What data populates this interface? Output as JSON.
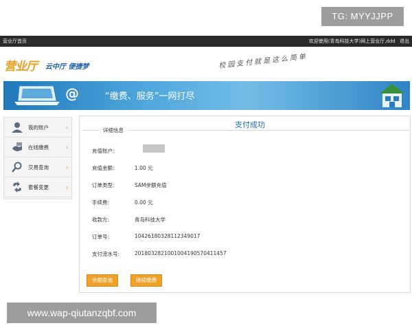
{
  "watermarks": {
    "tg": "TG: MYYJJPP",
    "url": "www.wap-qiutanzqbf.com"
  },
  "topbar": {
    "home": "营业厅首页",
    "welcome": "欢迎使用(青岛科技大学)网上营业厅,ddd",
    "logout": "退出"
  },
  "header": {
    "logo": "营业厅",
    "logo_sub": "云中厅 便捷梦",
    "slogan": "校园支付就是这么简单"
  },
  "banner": {
    "text": "“缴费、服务”一网打尽",
    "icon": "at-sign-icon"
  },
  "sidebar": {
    "items": [
      {
        "label": "我的账户",
        "icon": "user-icon"
      },
      {
        "label": "在线缴费",
        "icon": "payment-icon"
      },
      {
        "label": "交易查询",
        "icon": "search-icon"
      },
      {
        "label": "套餐变更",
        "icon": "change-icon"
      }
    ],
    "arrow": "›"
  },
  "main": {
    "title": "支付成功",
    "legend": "详细信息",
    "rows": [
      {
        "label": "充值账户:",
        "value": ""
      },
      {
        "label": "充值金额:",
        "value": "1.00 元"
      },
      {
        "label": "订单类型:",
        "value": "SAM余额充值"
      },
      {
        "label": "手续费:",
        "value": "0.00 元"
      },
      {
        "label": "收款方:",
        "value": "青岛科技大学"
      },
      {
        "label": "订单号:",
        "value": "10426180328112349017"
      },
      {
        "label": "支付流水号:",
        "value": "20180328210010041905704114​57"
      }
    ],
    "buttons": {
      "balance_query": "余额查询",
      "continue_pay": "继续缴费"
    }
  },
  "colors": {
    "accent": "#1f6cb4",
    "button": "#f0a12a",
    "topbar": "#2a2a2a"
  }
}
